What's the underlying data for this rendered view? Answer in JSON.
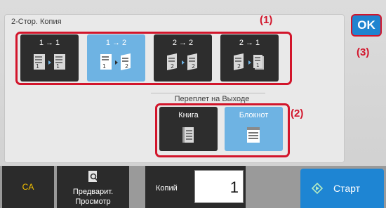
{
  "copy_section": {
    "title": "2-Стор. Копия",
    "options": [
      {
        "label": "1 → 1",
        "selected": false
      },
      {
        "label": "1 → 2",
        "selected": true
      },
      {
        "label": "2 → 2",
        "selected": false
      },
      {
        "label": "2 → 1",
        "selected": false
      }
    ]
  },
  "binding_section": {
    "title": "Переплет на Выходе",
    "options": [
      {
        "label": "Книга",
        "selected": false
      },
      {
        "label": "Блокнот",
        "selected": true
      }
    ]
  },
  "callouts": {
    "c1": "(1)",
    "c2": "(2)",
    "c3": "(3)"
  },
  "ok_label": "OK",
  "bottom": {
    "ca_label": "CA",
    "preview_label_1": "Предварит.",
    "preview_label_2": "Просмотр",
    "copies_label": "Копий",
    "copies_value": "1",
    "start_label": "Старт"
  },
  "colors": {
    "selected": "#6eb3e3",
    "callout": "#d2152b",
    "ok": "#1f84d0",
    "ca_text": "#f2c000",
    "start": "#1e85d3"
  },
  "icons": [
    "duplex-1-1-icon",
    "duplex-1-2-icon",
    "duplex-2-2-icon",
    "duplex-2-1-icon",
    "book-binding-icon",
    "tablet-binding-icon",
    "preview-icon",
    "start-icon"
  ]
}
